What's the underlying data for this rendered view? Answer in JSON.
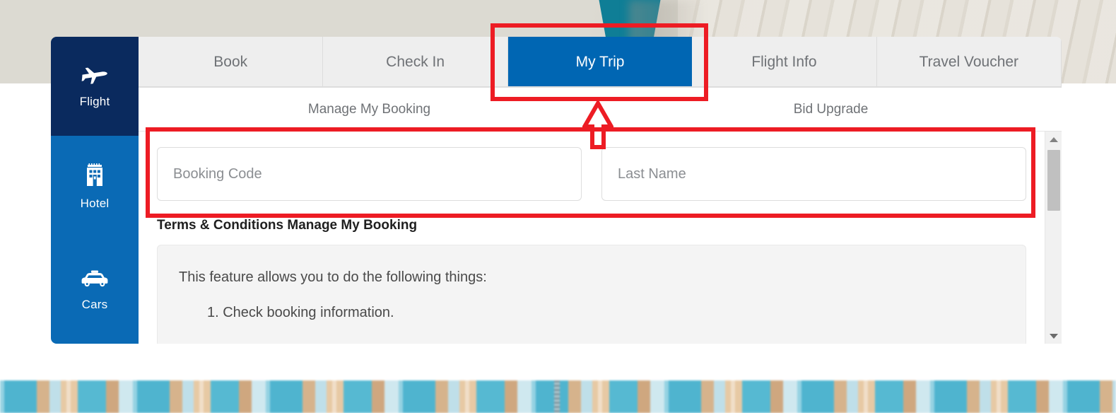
{
  "sidebar": {
    "items": [
      {
        "label": "Flight",
        "icon": "airplane-icon",
        "active": true
      },
      {
        "label": "Hotel",
        "icon": "hotel-building-icon",
        "active": false
      },
      {
        "label": "Cars",
        "icon": "taxi-car-icon",
        "active": false
      }
    ]
  },
  "tabs": [
    {
      "label": "Book",
      "active": false
    },
    {
      "label": "Check In",
      "active": false
    },
    {
      "label": "My Trip",
      "active": true
    },
    {
      "label": "Flight Info",
      "active": false
    },
    {
      "label": "Travel Voucher",
      "active": false
    }
  ],
  "subtabs": [
    {
      "label": "Manage My Booking",
      "active": true
    },
    {
      "label": "Bid Upgrade",
      "active": false
    }
  ],
  "form": {
    "booking_code": {
      "placeholder": "Booking Code",
      "value": ""
    },
    "last_name": {
      "placeholder": "Last Name",
      "value": ""
    }
  },
  "terms": {
    "title": "Terms & Conditions Manage My Booking",
    "intro": "This feature allows you to do the following things:",
    "items": [
      "1. Check booking information."
    ]
  },
  "scrollbar": {
    "up_arrow": "chevron-up-icon",
    "down_arrow": "chevron-down-icon"
  },
  "annotations": {
    "color": "#ED1C24",
    "highlight_tab": "My Trip",
    "highlight_fields": "Booking Code and Last Name inputs",
    "arrow": "up-arrow-pointing-to-my-trip-tab"
  },
  "colors": {
    "active_tab_blue": "#0066B3",
    "sidebar_active_navy": "#0A2A5E",
    "sidebar_blue": "#0A6AB5",
    "subtab_underline": "#1565C0",
    "annotation_red": "#ED1C24"
  }
}
